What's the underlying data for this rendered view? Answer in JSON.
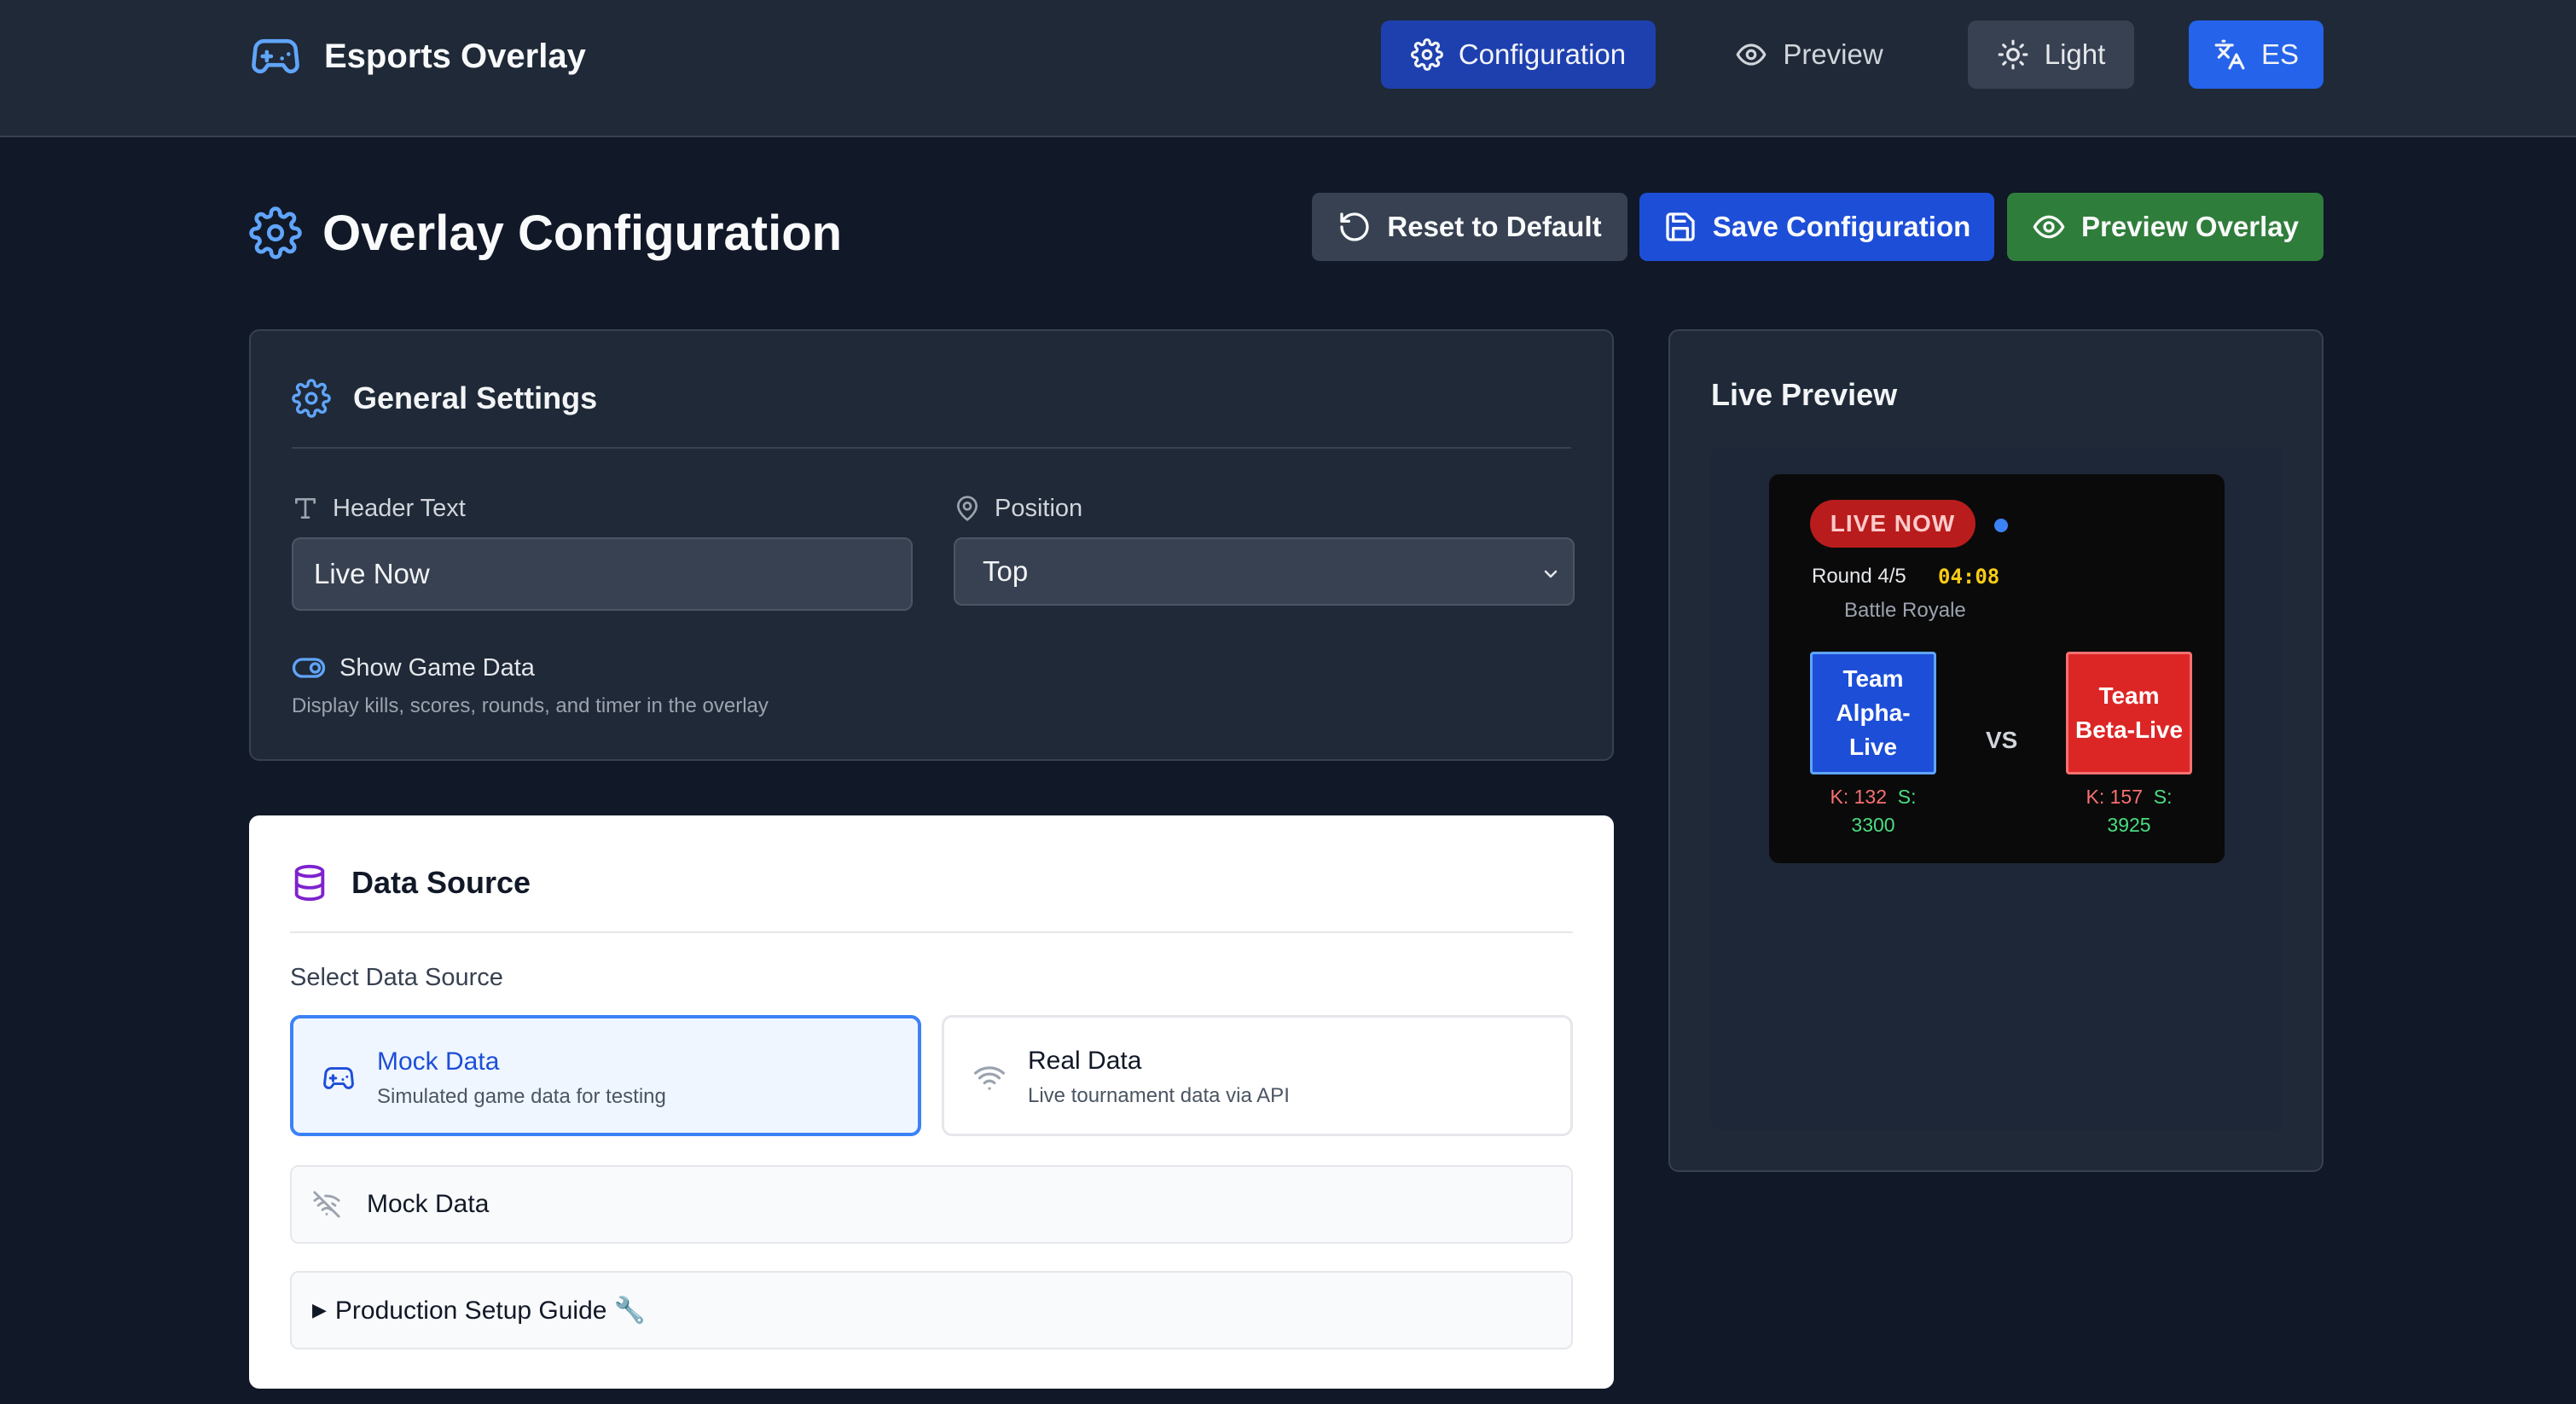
{
  "app": {
    "title": "Esports Overlay"
  },
  "nav": {
    "configuration": "Configuration",
    "preview": "Preview",
    "theme": "Light",
    "language": "ES"
  },
  "page": {
    "title": "Overlay Configuration",
    "reset_label": "Reset to Default",
    "save_label": "Save Configuration",
    "preview_label": "Preview Overlay"
  },
  "general": {
    "title": "General Settings",
    "header_text_label": "Header Text",
    "header_text_value": "Live Now",
    "position_label": "Position",
    "position_value": "Top",
    "show_game_data_label": "Show Game Data",
    "show_game_data_desc": "Display kills, scores, rounds, and timer in the overlay",
    "show_game_data_on": true
  },
  "data_source": {
    "title": "Data Source",
    "select_label": "Select Data Source",
    "options": [
      {
        "title": "Mock Data",
        "desc": "Simulated game data for testing",
        "selected": true,
        "icon": "gamepad-icon"
      },
      {
        "title": "Real Data",
        "desc": "Live tournament data via API",
        "selected": false,
        "icon": "wifi-icon"
      }
    ],
    "status": "Mock Data",
    "guide": "Production Setup Guide 🔧"
  },
  "live_preview": {
    "title": "Live Preview",
    "badge": "LIVE NOW",
    "round": "Round 4/5",
    "timer": "04:08",
    "mode": "Battle Royale",
    "vs": "VS",
    "team_a": {
      "name": "Team Alpha-Live",
      "kills_label": "K: 132",
      "score_label": "S: 3300"
    },
    "team_b": {
      "name": "Team Beta-Live",
      "kills_label": "K: 157",
      "score_label": "S: 3925"
    }
  },
  "colors": {
    "background": "#111827",
    "surface": "#1f2937",
    "accent_blue": "#1e40af",
    "accent_green": "#2f7d3b",
    "team_a": "#1d4ed8",
    "team_b": "#dc2626",
    "live_red": "#b91c1c",
    "timer_yellow": "#facc15"
  }
}
